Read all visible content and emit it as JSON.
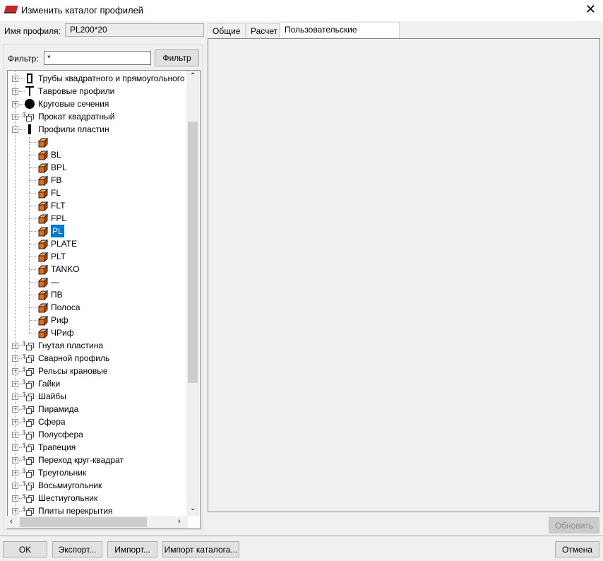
{
  "window": {
    "title": "Изменить каталог профилей",
    "close": "✕"
  },
  "profile": {
    "label": "Имя профиля:",
    "value": "PL200*20"
  },
  "filter": {
    "label": "Фильтр:",
    "value": "*",
    "button": "Фильтр"
  },
  "tree": [
    {
      "label": "Трубы квадратного и прямоугольного",
      "icon": "rect-tube",
      "level": 0
    },
    {
      "label": "Тавровые профили",
      "icon": "tee",
      "level": 0
    },
    {
      "label": "Круговые сечения",
      "icon": "circle",
      "level": 0
    },
    {
      "label": "Прокат квадратный",
      "icon": "parametric",
      "level": 0
    },
    {
      "label": "Профили пластин",
      "icon": "plate",
      "level": 0,
      "expanded": true
    },
    {
      "label": "",
      "icon": "box",
      "level": 1
    },
    {
      "label": "BL",
      "icon": "box",
      "level": 1
    },
    {
      "label": "BPL",
      "icon": "box",
      "level": 1
    },
    {
      "label": "FB",
      "icon": "box",
      "level": 1
    },
    {
      "label": "FL",
      "icon": "box",
      "level": 1
    },
    {
      "label": "FLT",
      "icon": "box",
      "level": 1
    },
    {
      "label": "FPL",
      "icon": "box",
      "level": 1
    },
    {
      "label": "PL",
      "icon": "box",
      "level": 1,
      "selected": true
    },
    {
      "label": "PLATE",
      "icon": "box",
      "level": 1
    },
    {
      "label": "PLT",
      "icon": "box",
      "level": 1
    },
    {
      "label": "TANKO",
      "icon": "box",
      "level": 1
    },
    {
      "label": "—",
      "icon": "box",
      "level": 1
    },
    {
      "label": "ПВ",
      "icon": "box",
      "level": 1
    },
    {
      "label": "Полоса",
      "icon": "box",
      "level": 1
    },
    {
      "label": "Риф",
      "icon": "box",
      "level": 1
    },
    {
      "label": "ЧРиф",
      "icon": "box",
      "level": 1
    },
    {
      "label": "Гнутая пластина",
      "icon": "parametric",
      "level": 0
    },
    {
      "label": "Сварной профиль",
      "icon": "parametric",
      "level": 0
    },
    {
      "label": "Рельсы крановые",
      "icon": "parametric",
      "level": 0
    },
    {
      "label": "Гайки",
      "icon": "parametric",
      "level": 0
    },
    {
      "label": "Шайбы",
      "icon": "parametric",
      "level": 0
    },
    {
      "label": "Пирамида",
      "icon": "parametric",
      "level": 0
    },
    {
      "label": "Сфера",
      "icon": "parametric",
      "level": 0
    },
    {
      "label": "Полусфера",
      "icon": "parametric",
      "level": 0
    },
    {
      "label": "Трапеция",
      "icon": "parametric",
      "level": 0
    },
    {
      "label": "Переход круг-квадрат",
      "icon": "parametric",
      "level": 0
    },
    {
      "label": "Треугольник",
      "icon": "parametric",
      "level": 0
    },
    {
      "label": "Восьмиугольник",
      "icon": "parametric",
      "level": 0
    },
    {
      "label": "Шестиугольник",
      "icon": "parametric",
      "level": 0
    },
    {
      "label": "Плиты перекрытия",
      "icon": "parametric",
      "level": 0
    }
  ],
  "tabs": [
    {
      "label": "Общие"
    },
    {
      "label": "Расчет"
    },
    {
      "label": "Пользовательские атрибуты",
      "active": true
    }
  ],
  "buttons": {
    "update": "Обновить",
    "ok": "OK",
    "export": "Экспорт...",
    "import": "Импорт...",
    "import_catalog": "Импорт каталога...",
    "cancel": "Отмена"
  },
  "colors": {
    "selection": "#0078d7",
    "box": "#e86a10"
  }
}
